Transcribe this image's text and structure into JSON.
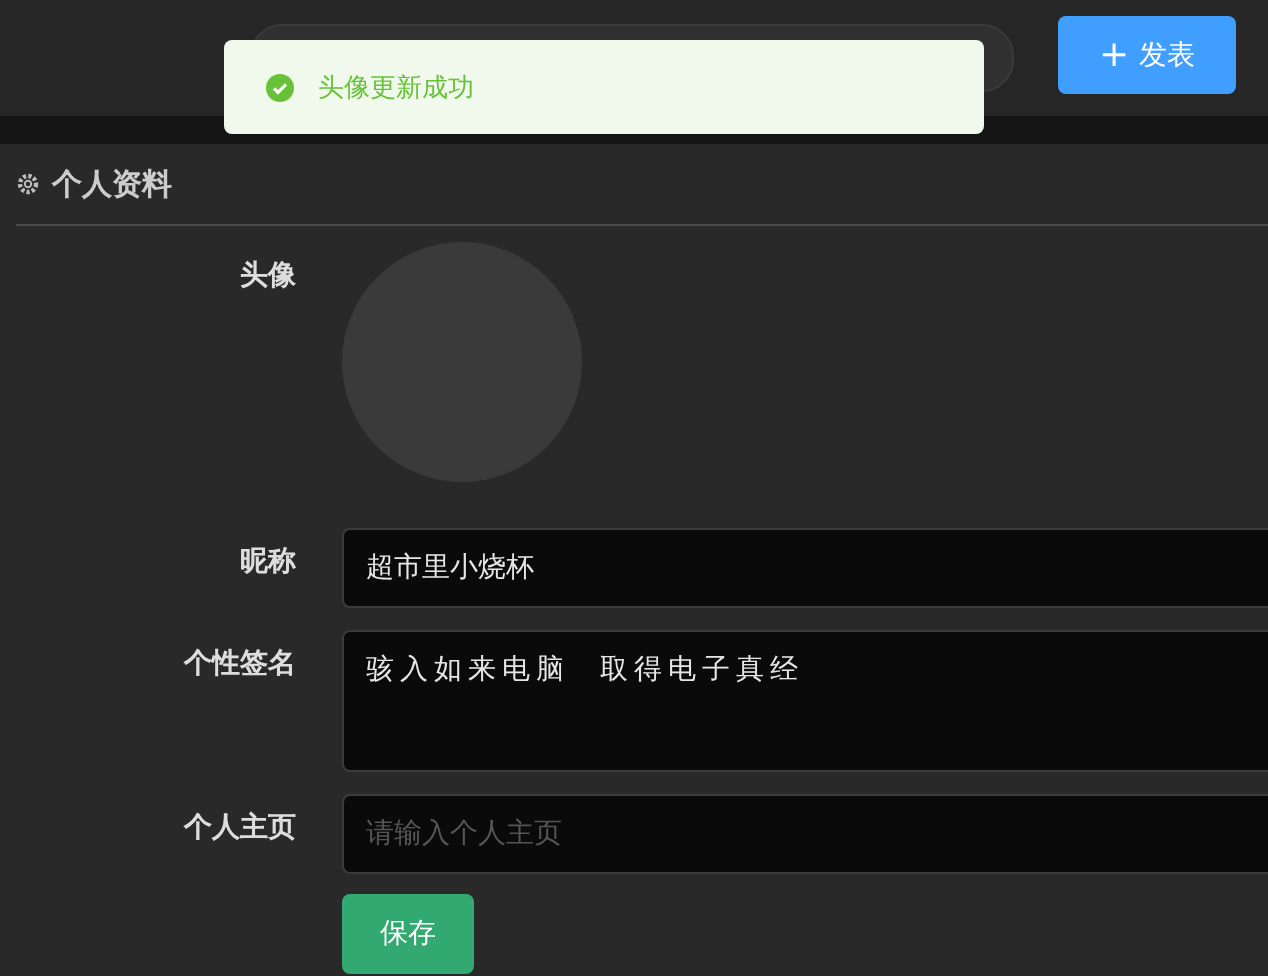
{
  "header": {
    "publish_button": {
      "icon": "+",
      "label": "发表"
    }
  },
  "toast": {
    "kind": "success",
    "message": "头像更新成功"
  },
  "section": {
    "title": "个人资料"
  },
  "form": [
    {
      "kind": "avatar",
      "label": "头像"
    },
    {
      "kind": "input",
      "label": "昵称",
      "value": "超市里小烧杯"
    },
    {
      "kind": "textarea",
      "label": "个性签名",
      "value": "骇入如来电脑  取得电子真经"
    },
    {
      "kind": "input",
      "label": "个人主页",
      "placeholder": "请输入个人主页"
    }
  ],
  "save_button": "保存"
}
